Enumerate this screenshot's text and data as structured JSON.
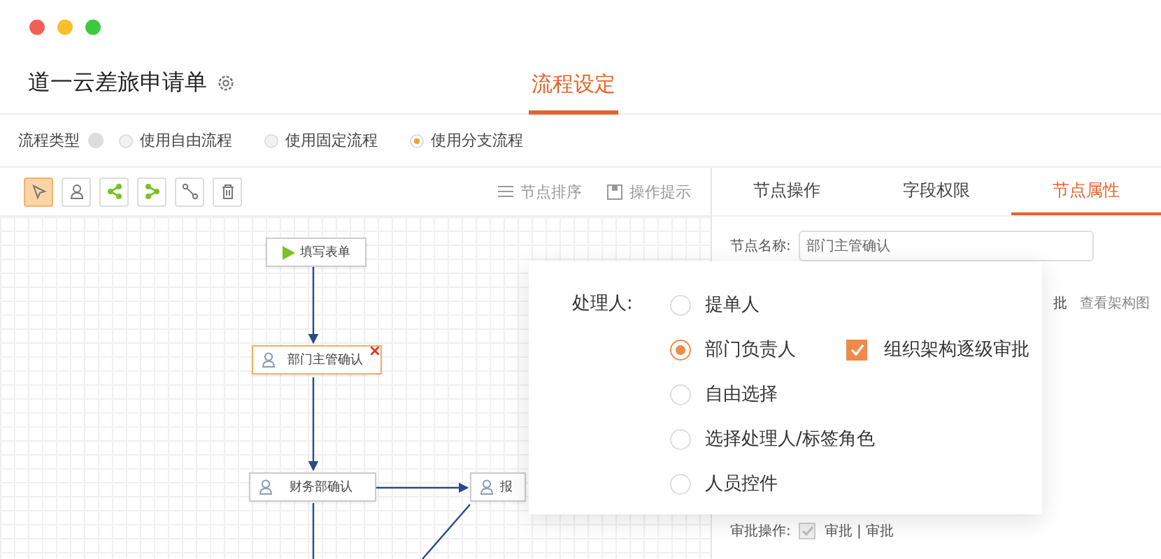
{
  "header": {
    "title": "道一云差旅申请单",
    "tabs": [
      {
        "label": "流程设定",
        "selected": true
      }
    ]
  },
  "flow_type": {
    "label": "流程类型",
    "options": [
      {
        "label": "使用自由流程",
        "selected": false
      },
      {
        "label": "使用固定流程",
        "selected": false
      },
      {
        "label": "使用分支流程",
        "selected": true
      }
    ]
  },
  "toolbar": {
    "tools": [
      {
        "kind": "pointer",
        "selected": true
      },
      {
        "kind": "person",
        "selected": false
      },
      {
        "kind": "split",
        "selected": false
      },
      {
        "kind": "merge",
        "selected": false
      },
      {
        "kind": "connector",
        "selected": false
      },
      {
        "kind": "trash",
        "selected": false
      }
    ],
    "actions": [
      {
        "kind": "sort",
        "label": "节点排序"
      },
      {
        "kind": "hint",
        "label": "操作提示"
      }
    ]
  },
  "canvas": {
    "nodes": [
      {
        "kind": "start",
        "label": "填写表单",
        "selected": false
      },
      {
        "kind": "task",
        "label": "部门主管确认",
        "selected": true
      },
      {
        "kind": "task",
        "label": "财务部确认",
        "selected": false
      },
      {
        "kind": "task",
        "label": "报",
        "selected": false
      }
    ]
  },
  "panel": {
    "tabs": [
      {
        "label": "节点操作",
        "selected": false
      },
      {
        "label": "字段权限",
        "selected": false
      },
      {
        "label": "节点属性",
        "selected": true
      }
    ],
    "node_name": {
      "label": "节点名称:",
      "value": "部门主管确认"
    },
    "partial_text": "批",
    "link": "查看架构图",
    "approval": {
      "label": "审批操作:",
      "checked": true,
      "text": "审批 | 审批"
    }
  },
  "popup": {
    "label": "处理人:",
    "options": [
      {
        "label": "提单人",
        "selected": false
      },
      {
        "label": "部门负责人",
        "selected": true,
        "extra": {
          "label": "组织架构逐级审批",
          "checked": true
        }
      },
      {
        "label": "自由选择",
        "selected": false
      },
      {
        "label": "选择处理人/标签角色",
        "selected": false
      },
      {
        "label": "人员控件",
        "selected": false
      }
    ]
  }
}
